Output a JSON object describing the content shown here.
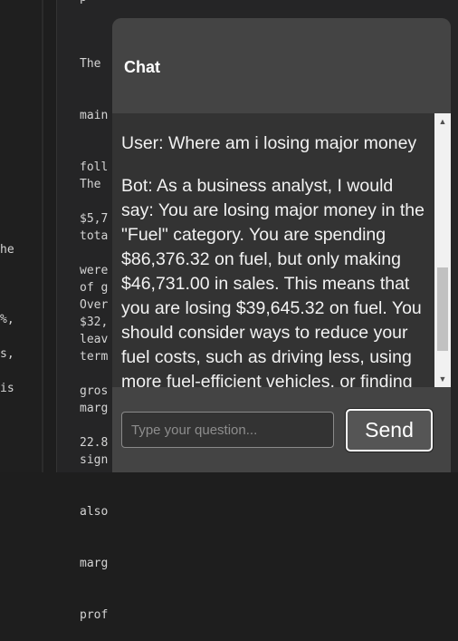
{
  "background_doc": {
    "top_cut_text": "p",
    "paragraphs": [
      {
        "lines": [
          "The",
          "main",
          "foll",
          "$5,7",
          "were",
          "$32,"
        ]
      },
      {
        "lines": [
          "The",
          "tota",
          "of g",
          "leav",
          "gros",
          "22.8"
        ]
      },
      {
        "lines": [
          "Over",
          "term",
          "marg",
          "sign",
          "also",
          "marg",
          "prof"
        ]
      }
    ],
    "gutter_fragments": [
      "he",
      "%,",
      "s,",
      "is"
    ]
  },
  "chat": {
    "title": "Chat",
    "messages": [
      {
        "role": "user",
        "text": "User: Where am i losing major money"
      },
      {
        "role": "bot",
        "text": "Bot: As a business analyst, I would say: You are losing major money in the \"Fuel\" category. You are spending $86,376.32 on fuel, but only making $46,731.00 in sales. This means that you are losing $39,645.32 on fuel. You should consider ways to reduce your fuel costs, such as driving less, using more fuel-efficient vehicles, or finding"
      }
    ],
    "input": {
      "value": "",
      "placeholder": "Type your question..."
    },
    "send_label": "Send"
  },
  "icons": {
    "scroll_up": "triangle-up-icon",
    "scroll_down": "triangle-down-icon"
  }
}
